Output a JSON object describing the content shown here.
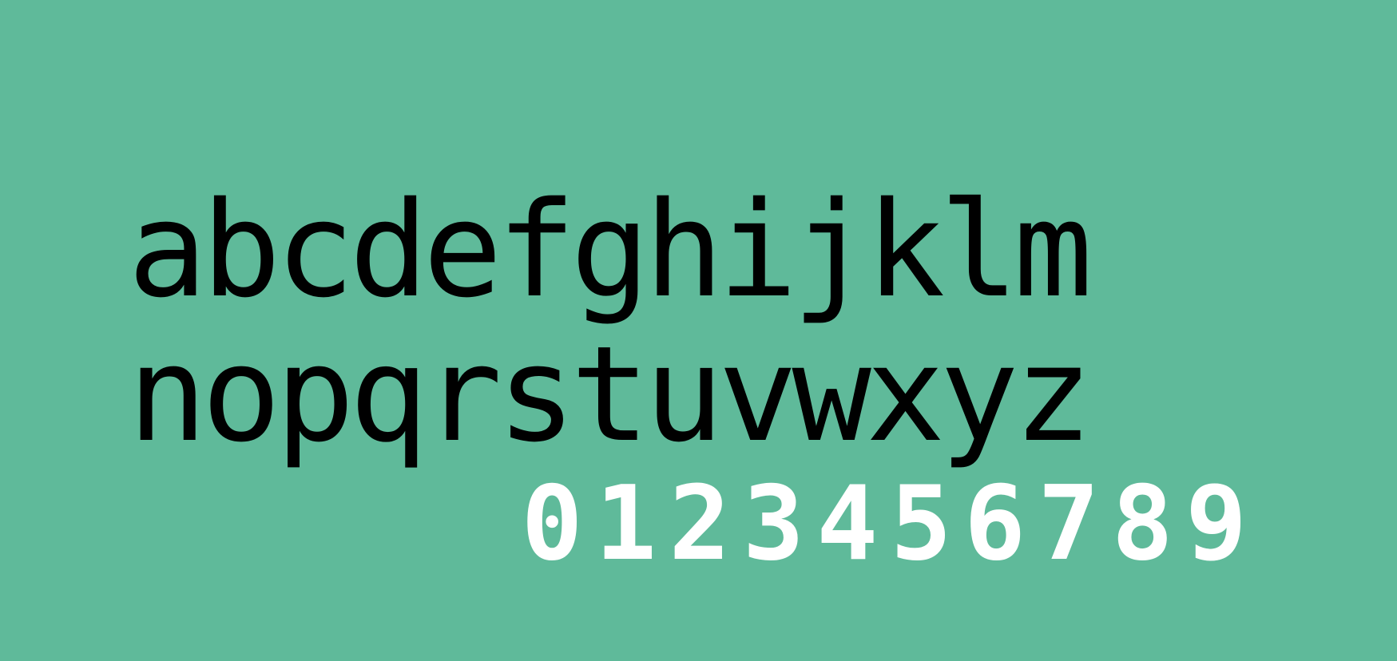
{
  "colors": {
    "background": "#5fba9a",
    "lowercase_text": "#000000",
    "digits_text": "#ffffff"
  },
  "specimen": {
    "lowercase_line_1": [
      "a",
      "b",
      "c",
      "d",
      "e",
      "f",
      "g",
      "h",
      "i",
      "j",
      "k",
      "l",
      "m"
    ],
    "lowercase_line_2": [
      "n",
      "o",
      "p",
      "q",
      "r",
      "s",
      "t",
      "u",
      "v",
      "w",
      "x",
      "y",
      "z"
    ],
    "digits_line": [
      "0",
      "1",
      "2",
      "3",
      "4",
      "5",
      "6",
      "7",
      "8",
      "9"
    ]
  }
}
